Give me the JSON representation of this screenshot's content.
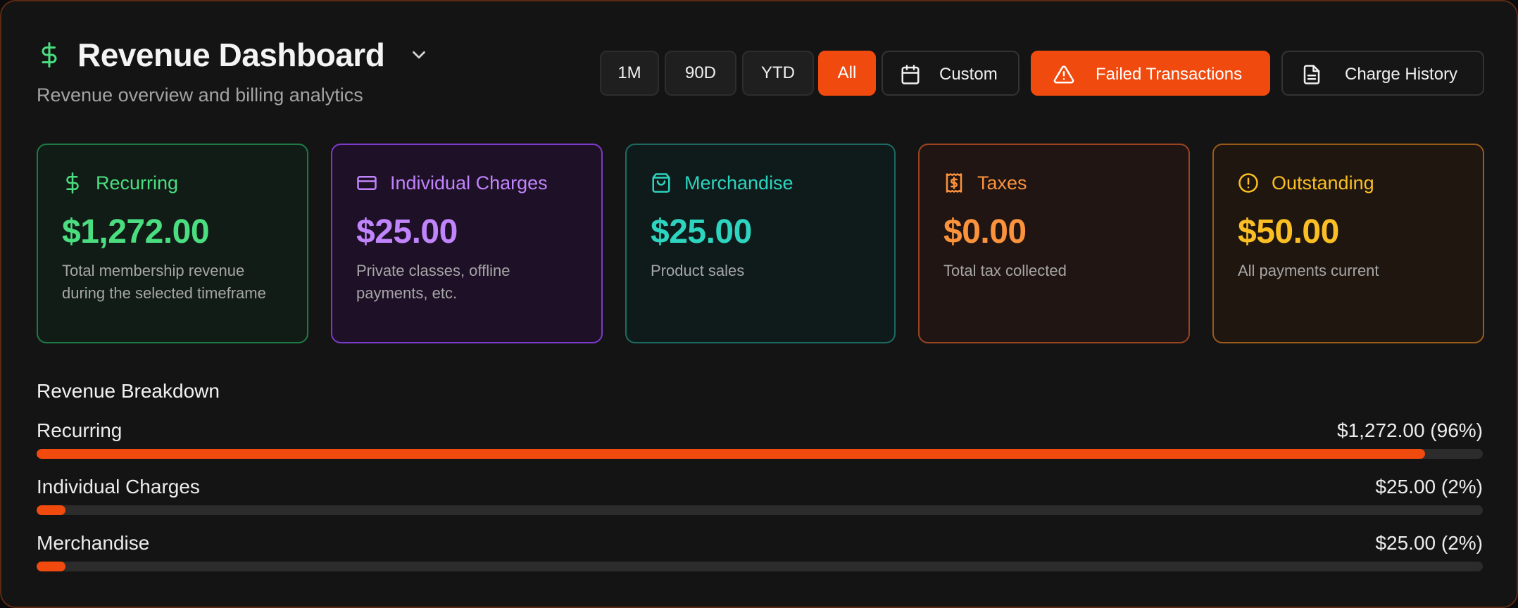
{
  "header": {
    "title": "Revenue Dashboard",
    "subtitle": "Revenue overview and billing analytics",
    "icon": "dollar-icon",
    "accent_color": "#4ade80"
  },
  "toolbar": {
    "ranges": [
      "1M",
      "90D",
      "YTD",
      "All"
    ],
    "selected_range": "All",
    "custom_label": "Custom",
    "failed_label": "Failed Transactions",
    "history_label": "Charge History",
    "accent_color": "#f04a0e"
  },
  "cards": [
    {
      "label": "Recurring",
      "value": "$1,272.00",
      "desc": "Total membership revenue during the selected timeframe",
      "icon": "dollar-icon",
      "color": "#4ade80"
    },
    {
      "label": "Individual Charges",
      "value": "$25.00",
      "desc": "Private classes, offline payments, etc.",
      "icon": "credit-card-icon",
      "color": "#c084fc"
    },
    {
      "label": "Merchandise",
      "value": "$25.00",
      "desc": "Product sales",
      "icon": "shopping-bag-icon",
      "color": "#2dd4bf"
    },
    {
      "label": "Taxes",
      "value": "$0.00",
      "desc": "Total tax collected",
      "icon": "receipt-icon",
      "color": "#fb923c"
    },
    {
      "label": "Outstanding",
      "value": "$50.00",
      "desc": "All payments current",
      "icon": "alert-circle-icon",
      "color": "#fbbf24"
    }
  ],
  "breakdown": {
    "title": "Revenue Breakdown",
    "rows": [
      {
        "label": "Recurring",
        "value": "$1,272.00 (96%)",
        "percent": 96
      },
      {
        "label": "Individual Charges",
        "value": "$25.00 (2%)",
        "percent": 2
      },
      {
        "label": "Merchandise",
        "value": "$25.00 (2%)",
        "percent": 2
      }
    ]
  }
}
